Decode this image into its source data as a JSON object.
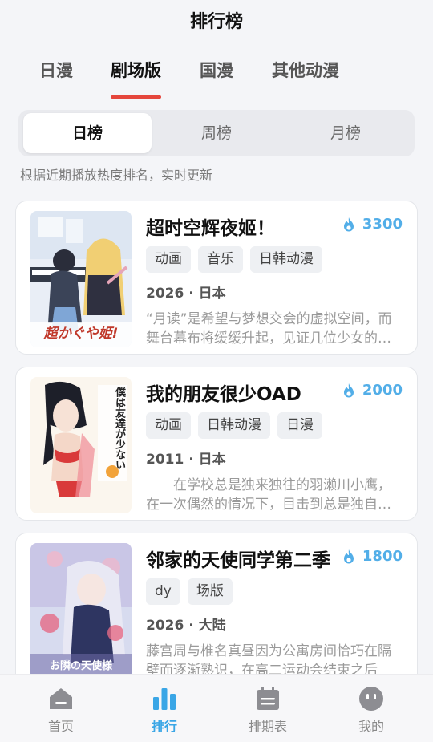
{
  "header": {
    "title": "排行榜"
  },
  "categories": [
    "日漫",
    "剧场版",
    "国漫",
    "其他动漫"
  ],
  "segments": [
    "日榜",
    "周榜",
    "月榜"
  ],
  "subtitle": "根据近期播放热度排名，实时更新",
  "cards": [
    {
      "title": "超时空辉夜姬！",
      "heat": "3300",
      "tags": [
        "动画",
        "音乐",
        "日韩动漫"
      ],
      "meta": "2026 · 日本",
      "desc": "“月读”是希望与梦想交会的虚拟空间，而舞台幕布将缓缓升起，见证几位少女的故事",
      "cover_logo": "超かぐや姫!"
    },
    {
      "title": "我的朋友很少OAD",
      "heat": "2000",
      "tags": [
        "动画",
        "日韩动漫",
        "日漫"
      ],
      "meta": "2011 · 日本",
      "desc": "　　在学校总是独来独往的羽濑川小鹰，在一次偶然的情况下，目击到总是独自一人的",
      "cover_logo": "僕は友達が少ない"
    },
    {
      "title": "邻家的天使同学第二季",
      "heat": "1800",
      "tags": [
        "dy",
        "场版"
      ],
      "meta": "2026 · 大陆",
      "desc": "藤宫周与椎名真昼因为公寓房间恰巧在隔壁而逐渐熟识，在高二运动会结束之后",
      "cover_logo": "お隣の天使様"
    }
  ],
  "nav": [
    "首页",
    "排行",
    "排期表",
    "我的"
  ],
  "colors": {
    "accent": "#e5463c",
    "heat": "#52aee8",
    "nav_active": "#3aa6e6"
  }
}
